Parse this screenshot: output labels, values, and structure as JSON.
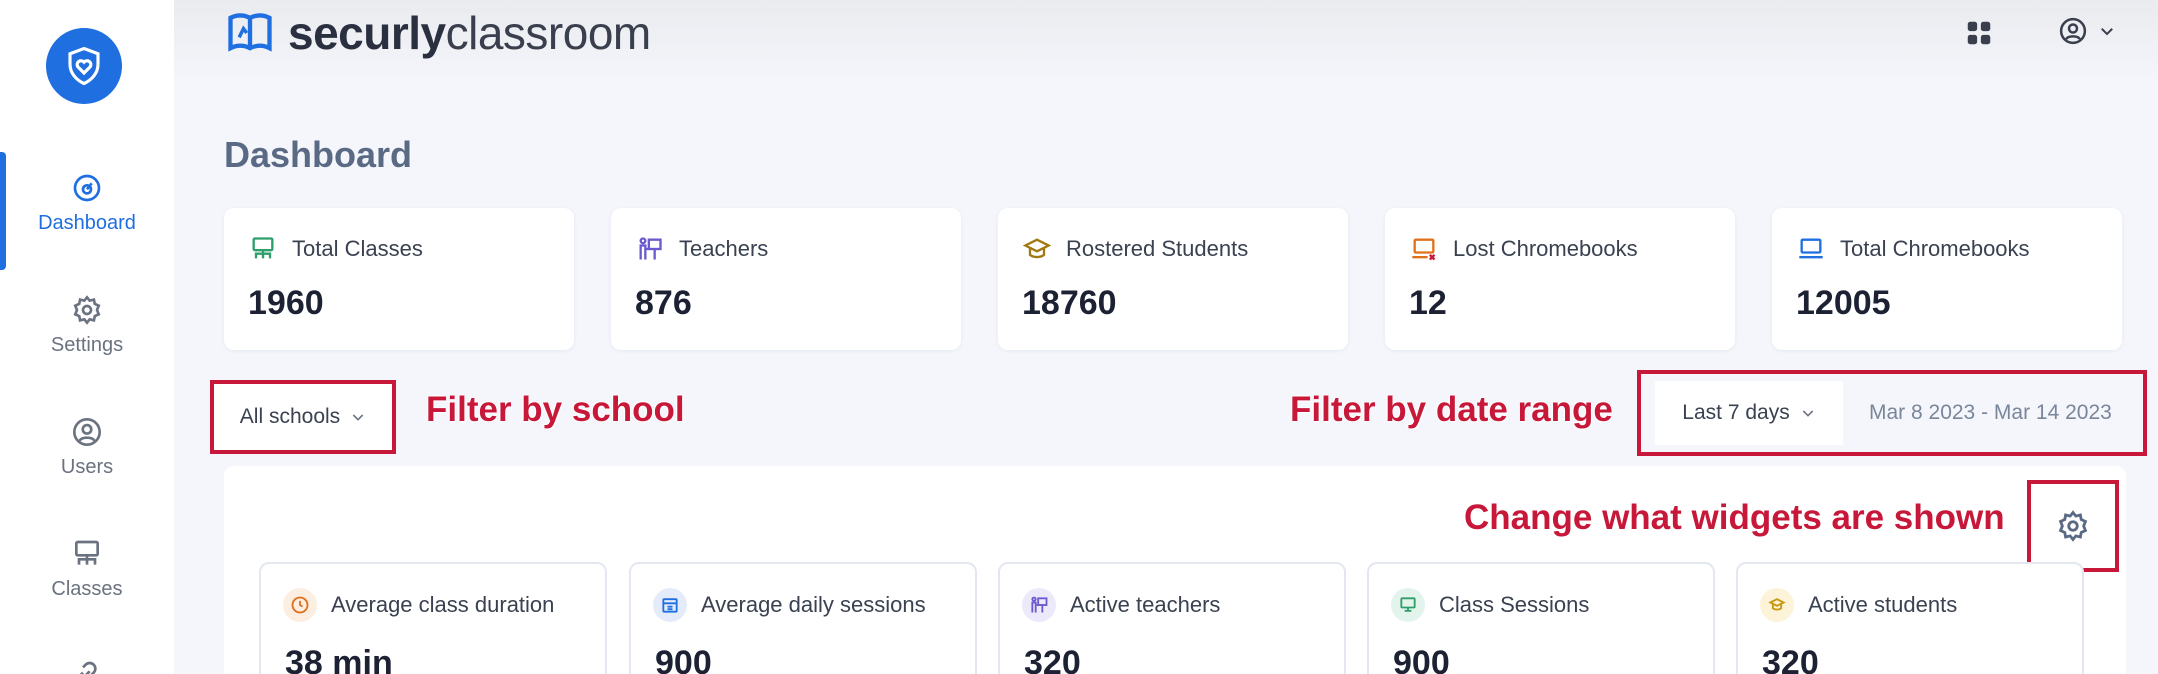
{
  "brand": {
    "name_bold": "securly",
    "name_light": "classroom"
  },
  "sidebar": {
    "items": [
      {
        "label": "Dashboard",
        "icon": "dashboard-icon"
      },
      {
        "label": "Settings",
        "icon": "gear-icon"
      },
      {
        "label": "Users",
        "icon": "user-icon"
      },
      {
        "label": "Classes",
        "icon": "classes-icon"
      }
    ]
  },
  "page": {
    "title": "Dashboard"
  },
  "stats": [
    {
      "label": "Total Classes",
      "value": "1960",
      "icon": "classroom-icon",
      "color": "#2e9e6b"
    },
    {
      "label": "Teachers",
      "value": "876",
      "icon": "teacher-icon",
      "color": "#6a5acd"
    },
    {
      "label": "Rostered Students",
      "value": "18760",
      "icon": "graduation-cap-icon",
      "color": "#a07a10"
    },
    {
      "label": "Lost Chromebooks",
      "value": "12",
      "icon": "laptop-alert-icon",
      "color": "#e0701a"
    },
    {
      "label": "Total Chromebooks",
      "value": "12005",
      "icon": "laptop-icon",
      "color": "#1f6fe0"
    }
  ],
  "filters": {
    "school": "All schools",
    "date_range": "Last 7 days",
    "date_value": "Mar 8 2023 - Mar 14 2023"
  },
  "annotations": {
    "school": "Filter by school",
    "date": "Filter by date range",
    "widgets": "Change what widgets are shown"
  },
  "widgets": [
    {
      "label": "Average class duration",
      "value": "38 min",
      "icon": "clock-icon",
      "bg": "#fdeee2",
      "color": "#e0701a"
    },
    {
      "label": "Average daily sessions",
      "value": "900",
      "icon": "calendar-icon",
      "bg": "#e4ecfb",
      "color": "#1f6fe0"
    },
    {
      "label": "Active teachers",
      "value": "320",
      "icon": "teacher-icon",
      "bg": "#ece9fb",
      "color": "#6a5acd"
    },
    {
      "label": "Class Sessions",
      "value": "900",
      "icon": "monitor-icon",
      "bg": "#e3f4ec",
      "color": "#2e9e6b"
    },
    {
      "label": "Active students",
      "value": "320",
      "icon": "student-icon",
      "bg": "#fdf3d8",
      "color": "#c99a10"
    }
  ],
  "colors": {
    "accent": "#1f6fe0",
    "annotation": "#c8183a"
  }
}
